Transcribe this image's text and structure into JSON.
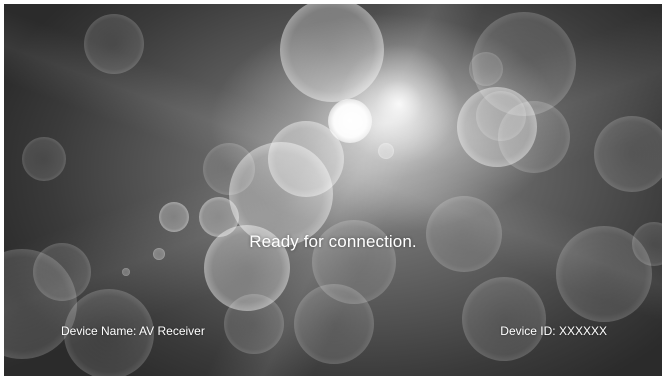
{
  "screen": {
    "status_message": "Ready for connection.",
    "device_name_label": "Device Name: AV Receiver",
    "device_id_label": "Device ID: XXXXXX"
  },
  "colors": {
    "text": "#ffffff",
    "background_dark": "#2b2b2b",
    "background_light": "#8a8a8a"
  },
  "background": {
    "style": "grayscale bokeh light"
  }
}
